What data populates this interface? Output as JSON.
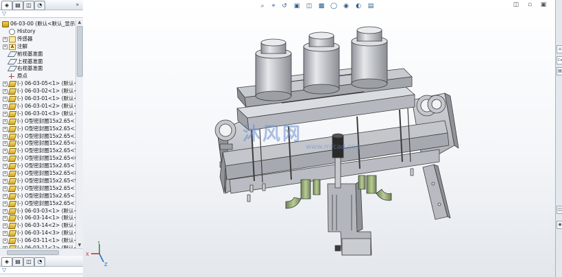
{
  "feature_manager": {
    "root_label": "06-03-00  (默认<默认_显示状",
    "items": [
      {
        "label": "History",
        "icon": "history-icon"
      },
      {
        "label": "传感器",
        "icon": "sensors-icon"
      },
      {
        "label": "注解",
        "icon": "annotations-icon"
      },
      {
        "label": "前视基准面",
        "icon": "plane-icon"
      },
      {
        "label": "上视基准面",
        "icon": "plane-icon"
      },
      {
        "label": "右视基准面",
        "icon": "plane-icon"
      },
      {
        "label": "原点",
        "icon": "origin-icon"
      }
    ],
    "components": [
      "(-) 06-03-05<1> (默认<",
      "(-) 06-03-02<1> (默认<",
      "(-) 06-03-01<1> (默认<",
      "(-) 06-03-01<2> (默认<",
      "(-) 06-03-01<3> (默认<",
      "(-) O型密封圈15x2.65<1>",
      "(-) O型密封圈15x2.65<2>",
      "(-) O型密封圈15x2.65<3>",
      "(-) O型密封圈15x2.65<4>",
      "(-) O型密封圈15x2.65<5>",
      "(-) O型密封圈15x2.65<6>",
      "(-) O型密封圈15x2.65<7>",
      "(-) O型密封圈15x2.65<8>",
      "(-) O型密封圈15x2.65<9>",
      "(-) O型密封圈15x2.65<10",
      "(-) O型密封圈15x2.65<11",
      "(-) O型密封圈15x2.65<12",
      "(-) 06-03-03<1> (默认<",
      "(-) 06-03-14<1> (默认<",
      "(-) 06-03-14<2> (默认<",
      "(-) 06-03-14<3> (默认<",
      "(-) 06-03-11<1> (默认<",
      "(-) 06-03-11<2> (默认<"
    ]
  },
  "triad": {
    "x": "X",
    "y": "Y",
    "z": "Z"
  },
  "watermark": {
    "text": "沐风网",
    "url": "www.mfcad.com"
  },
  "taskpane": {
    "tab_label": "Co"
  },
  "colors": {
    "model_body": "#b9bcc2",
    "model_edge": "#3c3c3c",
    "fitting_green": "#8da06d",
    "cylinder_dark": "#2a2a2a",
    "panel_bg": "#f3f5f8"
  }
}
